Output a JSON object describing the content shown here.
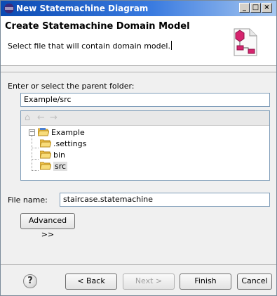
{
  "window": {
    "title": "New Statemachine Diagram"
  },
  "banner": {
    "heading": "Create Statemachine Domain Model",
    "description": "Select file that will contain domain model."
  },
  "parent_folder": {
    "label": "Enter or select the parent folder:",
    "value": "Example/src"
  },
  "tree": {
    "root": "Example",
    "children": [
      ".settings",
      "bin",
      "src"
    ],
    "selected": "src"
  },
  "file_name": {
    "label": "File name:",
    "value": "staircase.statemachine"
  },
  "advanced_label": "Advanced >>",
  "footer": {
    "help": "?",
    "back_label": "< Back",
    "next_label": "Next >",
    "finish_label": "Finish",
    "cancel_label": "Cancel"
  },
  "colors": {
    "titlebar": "#0b4bb3",
    "folder": "#f0c24a"
  }
}
